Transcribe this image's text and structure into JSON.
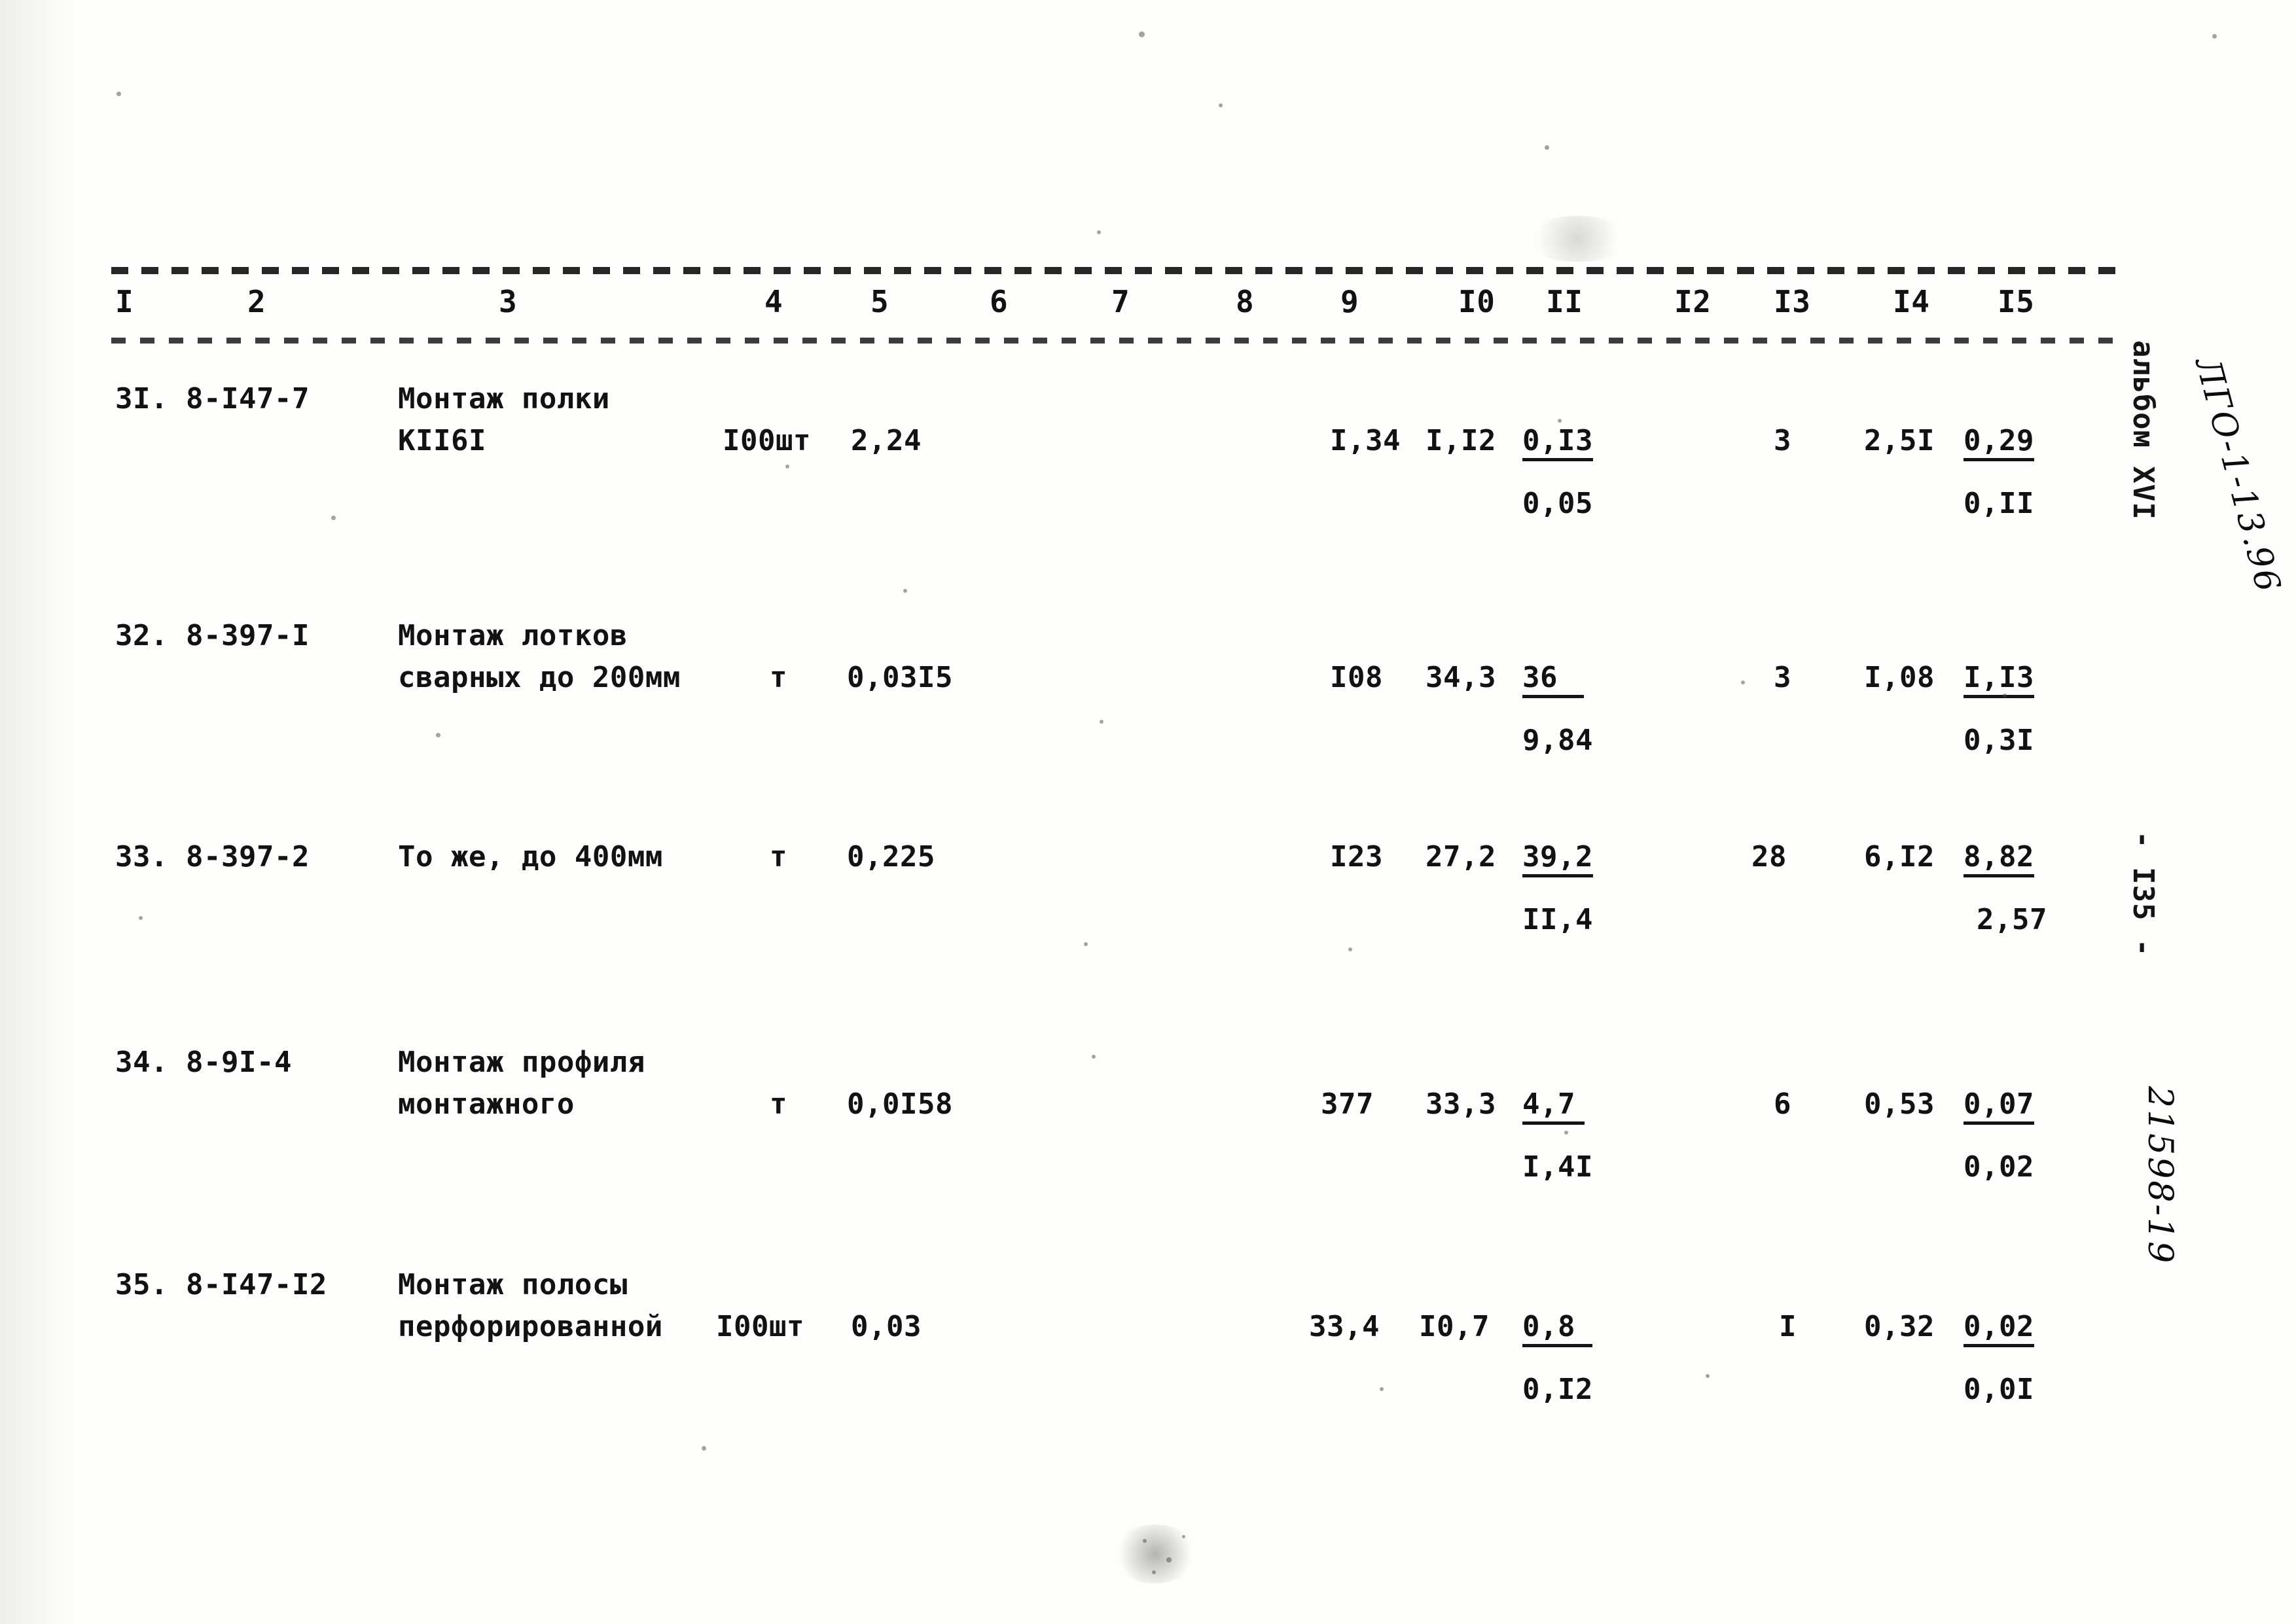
{
  "document": {
    "type": "typewritten-estimate-table",
    "page_label": "- I35 -",
    "album_label": "альбом XVI",
    "handwritten_code": "ЛГО-1-13.96",
    "handwritten_number": "21598-19"
  },
  "table": {
    "column_headers": [
      "I",
      "2",
      "3",
      "4",
      "5",
      "6",
      "7",
      "8",
      "9",
      "I0",
      "II",
      "I2",
      "I3",
      "I4",
      "I5"
    ],
    "rows": [
      {
        "num": "3I.",
        "code": "8-I47-7",
        "desc_line1": "Монтаж полки",
        "desc_line2": "КII6I",
        "unit": "I00шт",
        "qty": "2,24",
        "c9": "I,34",
        "c10": "I,I2",
        "c11_top": "0,I3",
        "c11_bottom": "0,05",
        "c13": "3",
        "c14": "2,5I",
        "c15_top": "0,29",
        "c15_bottom": "0,II"
      },
      {
        "num": "32.",
        "code": "8-397-I",
        "desc_line1": "Монтаж лотков",
        "desc_line2": "сварных до 200мм",
        "unit": "т",
        "qty": "0,03I5",
        "c9": "I08",
        "c10": "34,3",
        "c11_top": "36",
        "c11_bottom": "9,84",
        "c13": "3",
        "c14": "I,08",
        "c15_top": "I,I3",
        "c15_bottom": "0,3I"
      },
      {
        "num": "33.",
        "code": "8-397-2",
        "desc_line1": "То же, до 400мм",
        "desc_line2": "",
        "unit": "т",
        "qty": "0,225",
        "c9": "I23",
        "c10": "27,2",
        "c11_top": "39,2",
        "c11_bottom": "II,4",
        "c13": "28",
        "c14": "6,I2",
        "c15_top": "8,82",
        "c15_bottom": "2,57"
      },
      {
        "num": "34.",
        "code": "8-9I-4",
        "desc_line1": "Монтаж профиля",
        "desc_line2": "монтажного",
        "unit": "т",
        "qty": "0,0I58",
        "c9": "377",
        "c10": "33,3",
        "c11_top": "4,7",
        "c11_bottom": "I,4I",
        "c13": "6",
        "c14": "0,53",
        "c15_top": "0,07",
        "c15_bottom": "0,02"
      },
      {
        "num": "35.",
        "code": "8-I47-I2",
        "desc_line1": "Монтаж полосы",
        "desc_line2": "перфорированной",
        "unit": "I00шт",
        "qty": "0,03",
        "c9": "33,4",
        "c10": "I0,7",
        "c11_top": "0,8",
        "c11_bottom": "0,I2",
        "c13": "I",
        "c14": "0,32",
        "c15_top": "0,02",
        "c15_bottom": "0,0I"
      }
    ]
  }
}
